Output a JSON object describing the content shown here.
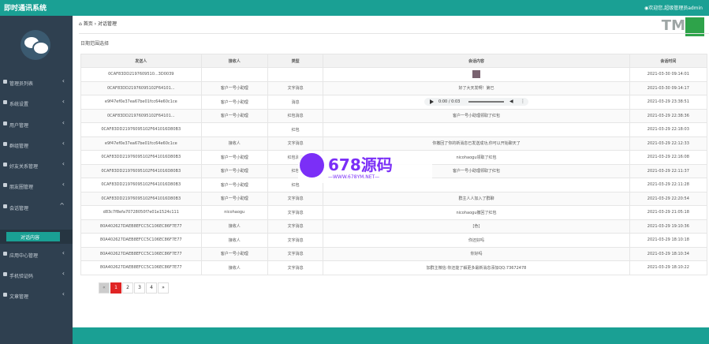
{
  "header": {
    "title": "即时通讯系统",
    "user": "◉欢迎您,超级管理员admin"
  },
  "sidebar": {
    "items": [
      {
        "label": "管理员列表",
        "arrow": "‹"
      },
      {
        "label": "系统设置",
        "arrow": "‹"
      },
      {
        "label": "用户管理",
        "arrow": "‹"
      },
      {
        "label": "群组管理",
        "arrow": "‹"
      },
      {
        "label": "好友关系管理",
        "arrow": "‹"
      },
      {
        "label": "朋友圈管理",
        "arrow": "‹"
      },
      {
        "label": "会话管理",
        "arrow": "^"
      },
      {
        "label": "应用中心管理",
        "arrow": "‹"
      },
      {
        "label": "手机验证码",
        "arrow": "‹"
      },
      {
        "label": "文章管理",
        "arrow": "‹"
      }
    ],
    "active_sub": "对话内容"
  },
  "breadcrumb": {
    "home": "首页",
    "current": "对话管理"
  },
  "filter": "日期范围选择",
  "table": {
    "headers": [
      "发送人",
      "接收人",
      "类型",
      "会话内容",
      "会话时间"
    ],
    "rows": [
      {
        "a": "0CAF83DD2197609510...3D0039",
        "b": "",
        "c": "",
        "d": "",
        "e": "2021-03-30 09:14:01",
        "d_type": "image"
      },
      {
        "a": "0CAF83DD21976095102F64101...",
        "b": "客户一号小助理",
        "c": "文字消息",
        "d": "好了大天发啊！第已",
        "e": "2021-03-30 09:14:17",
        "d_type": "text"
      },
      {
        "a": "e9f47ef0e37ea67be01fcc64e60c1ce",
        "b": "客户一号小助理",
        "c": "消息",
        "d": "",
        "e": "2021-03-29 23:38:51",
        "d_type": "audio"
      },
      {
        "a": "0CAF83DD21976095102F64101...",
        "b": "客户一号小助理",
        "c": "红包消息",
        "d": "客户一号小助理领取了红包",
        "e": "2021-03-29 22:38:36",
        "d_type": "text"
      },
      {
        "a": "0CAF83DD21976095102F641016D80B3",
        "b": "",
        "c": "红包",
        "d": "",
        "e": "2021-03-29 22:18:03",
        "d_type": "text"
      },
      {
        "a": "e9f47ef0e37ea67be01fcc64e60c1ce",
        "b": "接收人",
        "c": "文字消息",
        "d": "你撤回了你的新消息已发送成功,你可以开始聊天了",
        "e": "2021-03-29 22:12:33",
        "d_type": "text"
      },
      {
        "a": "0CAF83DD21976095102F641016D80B3",
        "b": "客户一号小助理",
        "c": "红包消息",
        "d": "nicohaogu领取了红包",
        "e": "2021-03-29 22:16:08",
        "d_type": "text"
      },
      {
        "a": "0CAF83DD21976095102F641016D80B3",
        "b": "客户一号小助理",
        "c": "红包",
        "d": "客户一号小助理领取了红包",
        "e": "2021-03-29 22:11:37",
        "d_type": "text"
      },
      {
        "a": "0CAF83DD21976095102F641016D80B3",
        "b": "客户一号小助理",
        "c": "红包",
        "d": "",
        "e": "2021-03-29 22:11:28",
        "d_type": "text"
      },
      {
        "a": "0CAF83DD21976095102F641016D80B3",
        "b": "客户一号小助理",
        "c": "文字消息",
        "d": "群主人人加入了群聊",
        "e": "2021-03-29 22:20:54",
        "d_type": "text"
      },
      {
        "a": "d83c7f8efa70728050f7e01e1524c111",
        "b": "nicohaogu",
        "c": "文字消息",
        "d": "nicohaogu撤回了红包",
        "e": "2021-03-29 21:05:18",
        "d_type": "text"
      },
      {
        "a": "80A402627DAEB8EFCC5C106EC86F7E77",
        "b": "接收人",
        "c": "文字消息",
        "d": "[色]",
        "e": "2021-03-29 19:10:36",
        "d_type": "text"
      },
      {
        "a": "80A402627DAEB8EFCC5C106EC86F7E77",
        "b": "接收人",
        "c": "文字消息",
        "d": "你还好吗",
        "e": "2021-03-29 18:10:18",
        "d_type": "text"
      },
      {
        "a": "80A402627DAEB8EFCC5C106EC86F7E77",
        "b": "客户一号小助理",
        "c": "文字消息",
        "d": "你好吗",
        "e": "2021-03-29 18:10:34",
        "d_type": "text"
      },
      {
        "a": "80A402627DAEB8EFCC5C106EC86F7E77",
        "b": "接收人",
        "c": "文字消息",
        "d": "加群主微信:你还能了解更多最新消息添加QQ:73672478",
        "e": "2021-03-29 18:10:22",
        "d_type": "text"
      }
    ]
  },
  "audio": {
    "time": "0:00 / 0:03"
  },
  "pagination": {
    "prev": "«",
    "pages": [
      "1",
      "2",
      "3",
      "4"
    ],
    "next": "»"
  },
  "watermark": {
    "brand": "678源码",
    "url": "—WWW.678YM.NET—"
  },
  "tm_logo": "TM"
}
